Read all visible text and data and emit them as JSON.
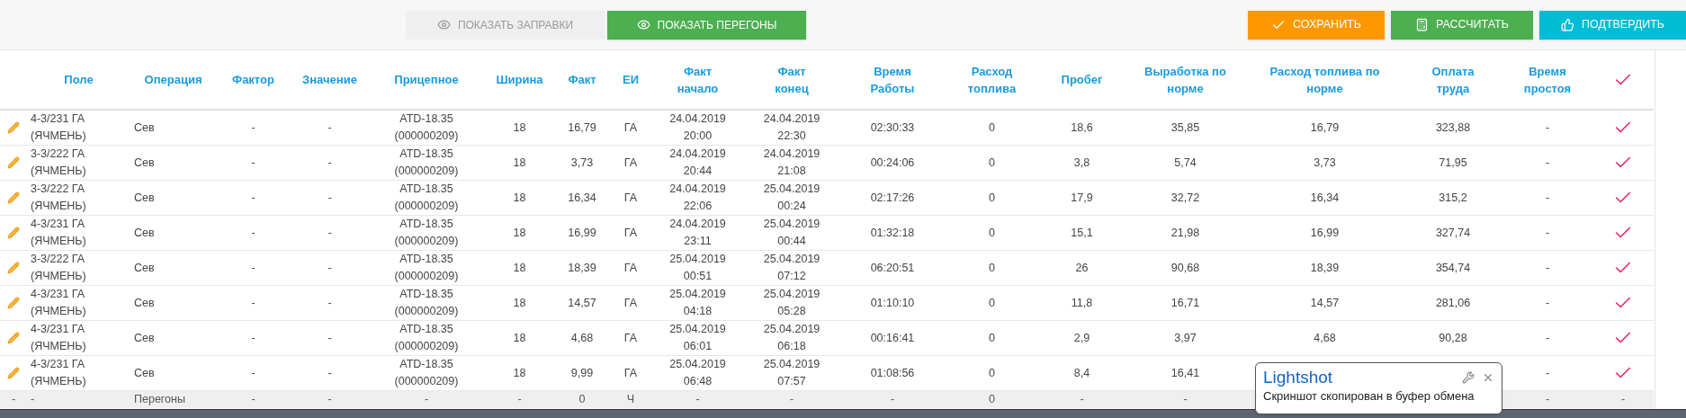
{
  "toolbar": {
    "left_buttons": [
      {
        "label": "ПОКАЗАТЬ ЗАПРАВКИ",
        "disabled": true,
        "color": "#efefef"
      },
      {
        "label": "ПОКАЗАТЬ ПЕРЕГОНЫ",
        "disabled": false,
        "color": "#4caf50"
      }
    ],
    "right_buttons": [
      {
        "label": "СОХРАНИТЬ",
        "kind": "save",
        "color": "#ff9800"
      },
      {
        "label": "РАССЧИТАТЬ",
        "kind": "calculate",
        "color": "#4caf50"
      },
      {
        "label": "ПОДТВЕРДИТЬ",
        "kind": "confirm",
        "color": "#00bcd4"
      }
    ]
  },
  "table": {
    "columns": [
      "Поле",
      "Операция",
      "Фактор",
      "Значение",
      "Прицепное",
      "Ширина",
      "Факт",
      "ЕИ",
      "Факт\nначало",
      "Факт\nконец",
      "Время\nРаботы",
      "Расход\nтоплива",
      "Пробег",
      "Выработка по\nнорме",
      "Расход топлива по\nнорме",
      "Оплата\nтруда",
      "Время\nпростоя"
    ],
    "rows": [
      {
        "confirmed": true,
        "cells": [
          "4-3/231 ГА\n(ЯЧМЕНЬ)",
          "Сев",
          "-",
          "-",
          "ATD-18.35\n(000000209)",
          "18",
          "16,79",
          "ГА",
          "24.04.2019\n20:00",
          "24.04.2019\n22:30",
          "02:30:33",
          "0",
          "18,6",
          "35,85",
          "16,79",
          "323,88",
          "-"
        ]
      },
      {
        "confirmed": true,
        "cells": [
          "3-3/222 ГА\n(ЯЧМЕНЬ)",
          "Сев",
          "-",
          "-",
          "ATD-18.35\n(000000209)",
          "18",
          "3,73",
          "ГА",
          "24.04.2019\n20:44",
          "24.04.2019\n21:08",
          "00:24:06",
          "0",
          "3,8",
          "5,74",
          "3,73",
          "71,95",
          "-"
        ]
      },
      {
        "confirmed": true,
        "cells": [
          "3-3/222 ГА\n(ЯЧМЕНЬ)",
          "Сев",
          "-",
          "-",
          "ATD-18.35\n(000000209)",
          "18",
          "16,34",
          "ГА",
          "24.04.2019\n22:06",
          "25.04.2019\n00:24",
          "02:17:26",
          "0",
          "17,9",
          "32,72",
          "16,34",
          "315,2",
          "-"
        ]
      },
      {
        "confirmed": true,
        "cells": [
          "4-3/231 ГА\n(ЯЧМЕНЬ)",
          "Сев",
          "-",
          "-",
          "ATD-18.35\n(000000209)",
          "18",
          "16,99",
          "ГА",
          "24.04.2019\n23:11",
          "25.04.2019\n00:44",
          "01:32:18",
          "0",
          "15,1",
          "21,98",
          "16,99",
          "327,74",
          "-"
        ]
      },
      {
        "confirmed": true,
        "cells": [
          "3-3/222 ГА\n(ЯЧМЕНЬ)",
          "Сев",
          "-",
          "-",
          "ATD-18.35\n(000000209)",
          "18",
          "18,39",
          "ГА",
          "25.04.2019\n00:51",
          "25.04.2019\n07:12",
          "06:20:51",
          "0",
          "26",
          "90,68",
          "18,39",
          "354,74",
          "-"
        ]
      },
      {
        "confirmed": true,
        "cells": [
          "4-3/231 ГА\n(ЯЧМЕНЬ)",
          "Сев",
          "-",
          "-",
          "ATD-18.35\n(000000209)",
          "18",
          "14,57",
          "ГА",
          "25.04.2019\n04:18",
          "25.04.2019\n05:28",
          "01:10:10",
          "0",
          "11,8",
          "16,71",
          "14,57",
          "281,06",
          "-"
        ]
      },
      {
        "confirmed": true,
        "cells": [
          "4-3/231 ГА\n(ЯЧМЕНЬ)",
          "Сев",
          "-",
          "-",
          "ATD-18.35\n(000000209)",
          "18",
          "4,68",
          "ГА",
          "25.04.2019\n06:01",
          "25.04.2019\n06:18",
          "00:16:41",
          "0",
          "2,9",
          "3,97",
          "4,68",
          "90,28",
          "-"
        ]
      },
      {
        "confirmed": true,
        "cells": [
          "4-3/231 ГА\n(ЯЧМЕНЬ)",
          "Сев",
          "-",
          "-",
          "ATD-18.35\n(000000209)",
          "18",
          "9,99",
          "ГА",
          "25.04.2019\n06:48",
          "25.04.2019\n07:57",
          "01:08:56",
          "0",
          "8,4",
          "16,41"
        ],
        "last_cells": [
          "-"
        ]
      }
    ],
    "footer": {
      "cells": [
        "-",
        "-",
        "Перегоны",
        "-",
        "-",
        "-",
        "-",
        "0",
        "Ч",
        "-",
        "-",
        "-",
        "0",
        "-",
        "-"
      ],
      "last_cells": [
        "-",
        "-"
      ]
    }
  },
  "notification": {
    "title": "Lightshot",
    "message": "Скриншот скопирован в буфер обмена"
  }
}
